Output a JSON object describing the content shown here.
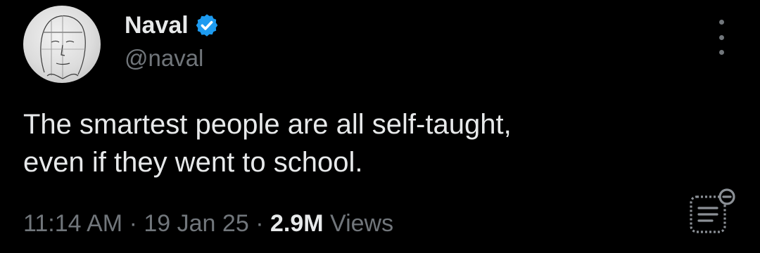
{
  "author": {
    "name": "Naval",
    "handle": "@naval",
    "verified": true,
    "avatar": "sketch-face-avatar"
  },
  "tweet": {
    "lines": [
      "The smartest people are all self-taught,",
      "even if they went to school."
    ]
  },
  "meta": {
    "time": "11:14 AM",
    "separator": "·",
    "date": "19 Jan 25",
    "views_count": "2.9M",
    "views_label": "Views"
  },
  "icons": {
    "verified": "verified-badge-icon",
    "more": "more-options-icon",
    "notes": "notes-icon"
  },
  "colors": {
    "background": "#000000",
    "primary_text": "#e7e9ea",
    "secondary_text": "#71767b",
    "verified_blue": "#1d9bf0"
  }
}
